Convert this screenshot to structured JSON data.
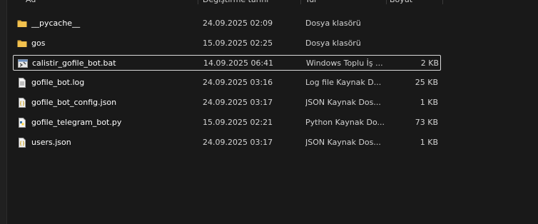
{
  "columns": {
    "name": "Ad",
    "date": "Değiştirme tarihi",
    "type": "Tür",
    "size": "Boyut"
  },
  "files": [
    {
      "name": "__pycache__",
      "date": "24.09.2025 02:09",
      "type": "Dosya klasörü",
      "size": "",
      "icon": "folder-icon"
    },
    {
      "name": "gos",
      "date": "15.09.2025 02:25",
      "type": "Dosya klasörü",
      "size": "",
      "icon": "folder-icon"
    },
    {
      "name": "calistir_gofile_bot.bat",
      "date": "14.09.2025 06:41",
      "type": "Windows Toplu İş ...",
      "size": "2 KB",
      "icon": "batch-file-icon"
    },
    {
      "name": "gofile_bot.log",
      "date": "24.09.2025 03:16",
      "type": "Log file Kaynak D...",
      "size": "25 KB",
      "icon": "text-file-icon"
    },
    {
      "name": "gofile_bot_config.json",
      "date": "24.09.2025 03:17",
      "type": "JSON Kaynak Dos...",
      "size": "1 KB",
      "icon": "json-file-icon"
    },
    {
      "name": "gofile_telegram_bot.py",
      "date": "15.09.2025 02:21",
      "type": "Python Kaynak Do...",
      "size": "73 KB",
      "icon": "python-file-icon"
    },
    {
      "name": "users.json",
      "date": "24.09.2025 03:17",
      "type": "JSON Kaynak Dos...",
      "size": "1 KB",
      "icon": "json-file-icon"
    }
  ],
  "colors": {
    "background": "#191919",
    "folder": "#f2c14e",
    "selection_border": "#d9d9d9"
  }
}
